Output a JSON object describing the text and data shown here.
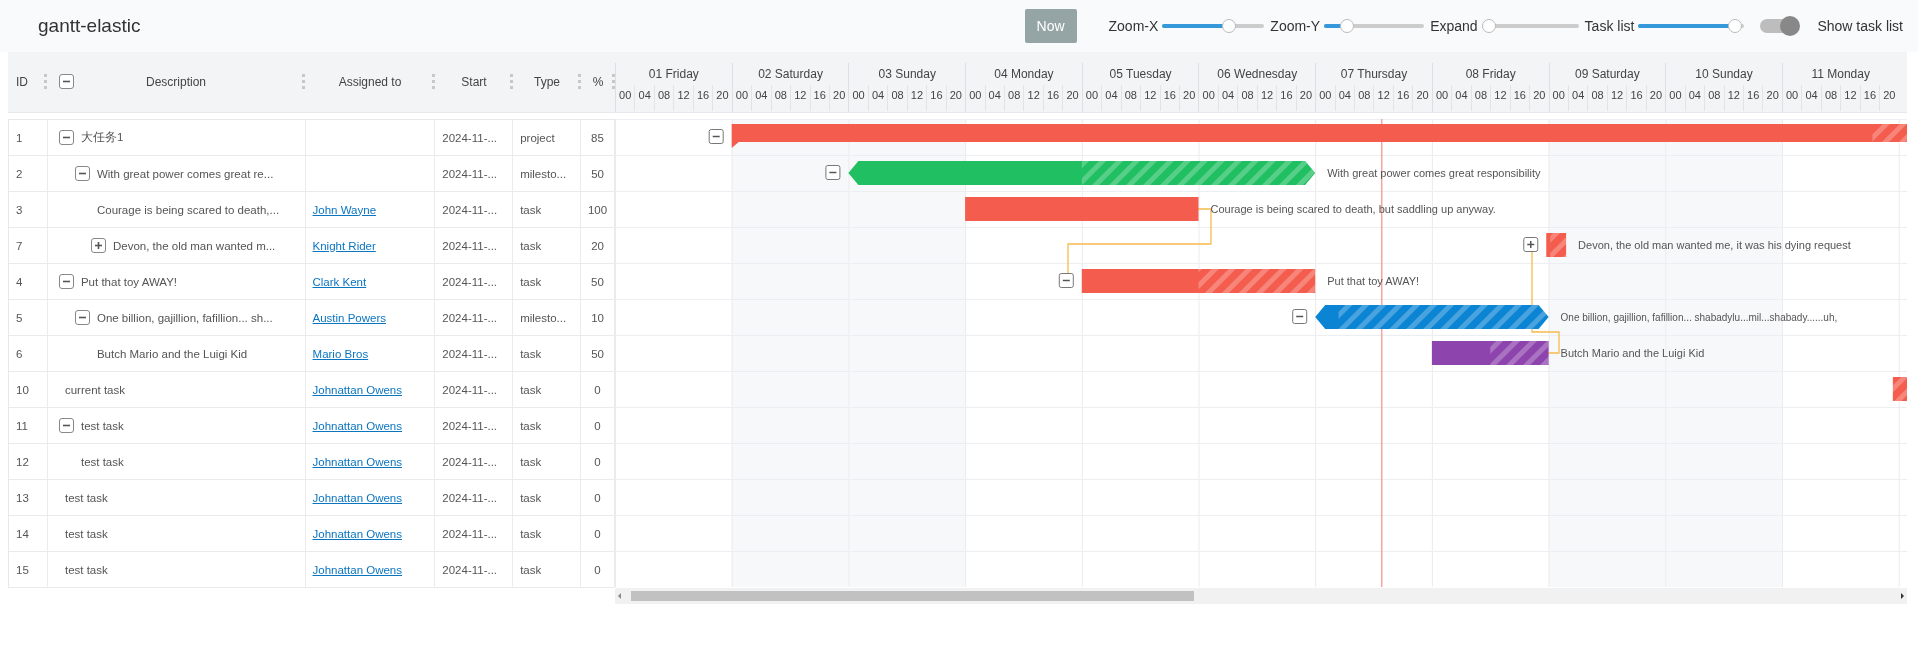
{
  "title": "gantt-elastic",
  "toolbar": {
    "now_button": "Now",
    "controls": [
      {
        "kind": "slider",
        "label": "Zoom-X",
        "level": 0.68
      },
      {
        "kind": "slider",
        "label": "Zoom-Y",
        "level": 0.18
      },
      {
        "kind": "slider",
        "label": "Expand",
        "level": 0
      },
      {
        "kind": "slider",
        "label": "Task list",
        "level": 0.97
      },
      {
        "kind": "switch",
        "label": "Show task list",
        "on": true
      }
    ]
  },
  "task_list": {
    "all_expanded": true,
    "columns": [
      "ID",
      "Description",
      "Assigned to",
      "Start",
      "Type",
      "%"
    ]
  },
  "days": [
    {
      "label": "01 Friday",
      "weekend": false,
      "hours": [
        "00",
        "04",
        "08",
        "12",
        "16",
        "20"
      ]
    },
    {
      "label": "02 Saturday",
      "weekend": true,
      "hours": [
        "00",
        "04",
        "08",
        "12",
        "16",
        "20"
      ]
    },
    {
      "label": "03 Sunday",
      "weekend": true,
      "hours": [
        "00",
        "04",
        "08",
        "12",
        "16",
        "20"
      ]
    },
    {
      "label": "04 Monday",
      "weekend": false,
      "hours": [
        "00",
        "04",
        "08",
        "12",
        "16",
        "20"
      ]
    },
    {
      "label": "05 Tuesday",
      "weekend": false,
      "hours": [
        "00",
        "04",
        "08",
        "12",
        "16",
        "20"
      ]
    },
    {
      "label": "06 Wednesday",
      "weekend": false,
      "hours": [
        "00",
        "04",
        "08",
        "12",
        "16",
        "20"
      ]
    },
    {
      "label": "07 Thursday",
      "weekend": false,
      "hours": [
        "00",
        "04",
        "08",
        "12",
        "16",
        "20"
      ]
    },
    {
      "label": "08 Friday",
      "weekend": false,
      "hours": [
        "00",
        "04",
        "08",
        "12",
        "16",
        "20"
      ]
    },
    {
      "label": "09 Saturday",
      "weekend": true,
      "hours": [
        "00",
        "04",
        "08",
        "12",
        "16",
        "20"
      ]
    },
    {
      "label": "10 Sunday",
      "weekend": true,
      "hours": [
        "00",
        "04",
        "08",
        "12",
        "16",
        "20"
      ]
    },
    {
      "label": "11 Monday",
      "weekend": false,
      "hours": [
        "00",
        "04",
        "08",
        "12",
        "16",
        "20"
      ]
    }
  ],
  "tasks": [
    {
      "id": "1",
      "description": "大任务1",
      "start": "2024-11-...",
      "type": "project",
      "percent": "85",
      "kind": "project",
      "color": "#f45c4d",
      "expanded": true,
      "children": [
        {
          "id": "2",
          "description": "With great power comes great re...",
          "start": "2024-11-...",
          "type": "milesto...",
          "percent": "50",
          "kind": "milestone",
          "color": "#1fbf62",
          "expanded": true,
          "bar_label": "With great power comes great responsibility",
          "children": [
            {
              "id": "3",
              "description": "Courage is being scared to death,...",
              "assigned": "John Wayne",
              "start": "2024-11-...",
              "type": "task",
              "percent": "100",
              "kind": "task",
              "color": "#f45c4d",
              "bar_label": "Courage is being scared to death, but saddling up anyway."
            },
            {
              "id": "7",
              "description": "Devon, the old man wanted m...",
              "assigned": "Knight Rider",
              "start": "2024-11-...",
              "type": "task",
              "percent": "20",
              "kind": "task",
              "color": "#f45c4d",
              "expanded": false,
              "bar_label": "Devon, the old man wanted me, it was his dying request"
            }
          ]
        }
      ]
    },
    {
      "id": "4",
      "description": "Put that toy AWAY!",
      "assigned": "Clark Kent",
      "start": "2024-11-...",
      "type": "task",
      "percent": "50",
      "kind": "task",
      "color": "#f45c4d",
      "expanded": true,
      "bar_label": "Put that toy AWAY!",
      "children": [
        {
          "id": "5",
          "description": "One billion, gajillion, fafillion... sh...",
          "assigned": "Austin Powers",
          "start": "2024-11-...",
          "type": "milesto...",
          "percent": "10",
          "kind": "milestone",
          "color": "#0b84d4",
          "expanded": true,
          "bar_label": "One billion, gajillion, fafillion... shabadylu...mil...shabady......uh,",
          "children": [
            {
              "id": "6",
              "description": "Butch Mario and the Luigi Kid",
              "assigned": "Mario Bros",
              "start": "2024-11-...",
              "type": "task",
              "percent": "50",
              "kind": "task",
              "color": "#8e44ad",
              "bar_label": "Butch Mario and the Luigi Kid"
            }
          ]
        }
      ]
    },
    {
      "id": "10",
      "description": "current task",
      "assigned": "Johnattan Owens",
      "start": "2024-11-...",
      "type": "task",
      "percent": "0",
      "kind": "task",
      "color": "#f45c4d"
    },
    {
      "id": "11",
      "description": "test task",
      "assigned": "Johnattan Owens",
      "start": "2024-11-...",
      "type": "task",
      "percent": "0",
      "expanded": true,
      "children": [
        {
          "id": "12",
          "description": "test task",
          "assigned": "Johnattan Owens",
          "start": "2024-11-...",
          "type": "task",
          "percent": "0"
        }
      ]
    },
    {
      "id": "13",
      "description": "test task",
      "assigned": "Johnattan Owens",
      "start": "2024-11-...",
      "type": "task",
      "percent": "0"
    },
    {
      "id": "14",
      "description": "test task",
      "assigned": "Johnattan Owens",
      "start": "2024-11-...",
      "type": "task",
      "percent": "0"
    },
    {
      "id": "15",
      "description": "test task",
      "assigned": "Johnattan Owens",
      "start": "2024-11-...",
      "type": "task",
      "percent": "0"
    }
  ]
}
